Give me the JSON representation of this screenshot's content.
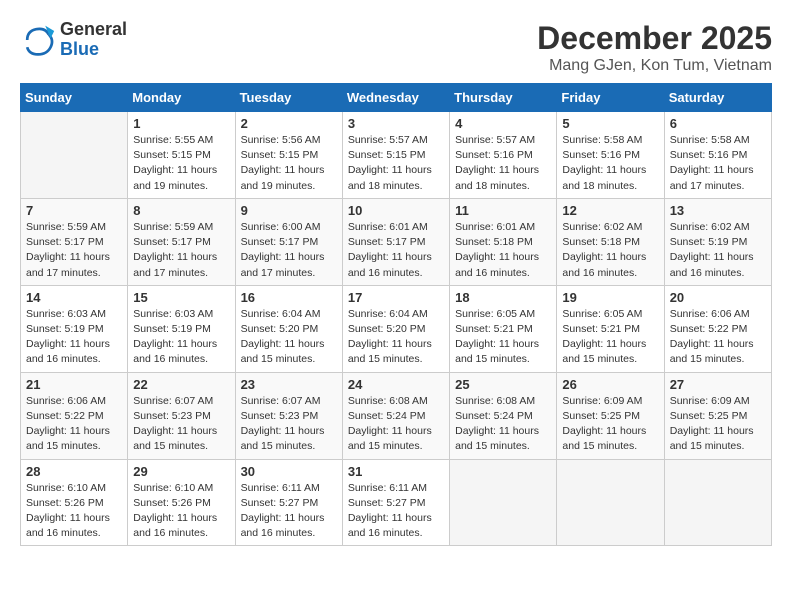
{
  "header": {
    "logo_general": "General",
    "logo_blue": "Blue",
    "title": "December 2025",
    "subtitle": "Mang GJen, Kon Tum, Vietnam"
  },
  "weekdays": [
    "Sunday",
    "Monday",
    "Tuesday",
    "Wednesday",
    "Thursday",
    "Friday",
    "Saturday"
  ],
  "weeks": [
    [
      {
        "day": "",
        "info": ""
      },
      {
        "day": "1",
        "info": "Sunrise: 5:55 AM\nSunset: 5:15 PM\nDaylight: 11 hours\nand 19 minutes."
      },
      {
        "day": "2",
        "info": "Sunrise: 5:56 AM\nSunset: 5:15 PM\nDaylight: 11 hours\nand 19 minutes."
      },
      {
        "day": "3",
        "info": "Sunrise: 5:57 AM\nSunset: 5:15 PM\nDaylight: 11 hours\nand 18 minutes."
      },
      {
        "day": "4",
        "info": "Sunrise: 5:57 AM\nSunset: 5:16 PM\nDaylight: 11 hours\nand 18 minutes."
      },
      {
        "day": "5",
        "info": "Sunrise: 5:58 AM\nSunset: 5:16 PM\nDaylight: 11 hours\nand 18 minutes."
      },
      {
        "day": "6",
        "info": "Sunrise: 5:58 AM\nSunset: 5:16 PM\nDaylight: 11 hours\nand 17 minutes."
      }
    ],
    [
      {
        "day": "7",
        "info": "Sunrise: 5:59 AM\nSunset: 5:17 PM\nDaylight: 11 hours\nand 17 minutes."
      },
      {
        "day": "8",
        "info": "Sunrise: 5:59 AM\nSunset: 5:17 PM\nDaylight: 11 hours\nand 17 minutes."
      },
      {
        "day": "9",
        "info": "Sunrise: 6:00 AM\nSunset: 5:17 PM\nDaylight: 11 hours\nand 17 minutes."
      },
      {
        "day": "10",
        "info": "Sunrise: 6:01 AM\nSunset: 5:17 PM\nDaylight: 11 hours\nand 16 minutes."
      },
      {
        "day": "11",
        "info": "Sunrise: 6:01 AM\nSunset: 5:18 PM\nDaylight: 11 hours\nand 16 minutes."
      },
      {
        "day": "12",
        "info": "Sunrise: 6:02 AM\nSunset: 5:18 PM\nDaylight: 11 hours\nand 16 minutes."
      },
      {
        "day": "13",
        "info": "Sunrise: 6:02 AM\nSunset: 5:19 PM\nDaylight: 11 hours\nand 16 minutes."
      }
    ],
    [
      {
        "day": "14",
        "info": "Sunrise: 6:03 AM\nSunset: 5:19 PM\nDaylight: 11 hours\nand 16 minutes."
      },
      {
        "day": "15",
        "info": "Sunrise: 6:03 AM\nSunset: 5:19 PM\nDaylight: 11 hours\nand 16 minutes."
      },
      {
        "day": "16",
        "info": "Sunrise: 6:04 AM\nSunset: 5:20 PM\nDaylight: 11 hours\nand 15 minutes."
      },
      {
        "day": "17",
        "info": "Sunrise: 6:04 AM\nSunset: 5:20 PM\nDaylight: 11 hours\nand 15 minutes."
      },
      {
        "day": "18",
        "info": "Sunrise: 6:05 AM\nSunset: 5:21 PM\nDaylight: 11 hours\nand 15 minutes."
      },
      {
        "day": "19",
        "info": "Sunrise: 6:05 AM\nSunset: 5:21 PM\nDaylight: 11 hours\nand 15 minutes."
      },
      {
        "day": "20",
        "info": "Sunrise: 6:06 AM\nSunset: 5:22 PM\nDaylight: 11 hours\nand 15 minutes."
      }
    ],
    [
      {
        "day": "21",
        "info": "Sunrise: 6:06 AM\nSunset: 5:22 PM\nDaylight: 11 hours\nand 15 minutes."
      },
      {
        "day": "22",
        "info": "Sunrise: 6:07 AM\nSunset: 5:23 PM\nDaylight: 11 hours\nand 15 minutes."
      },
      {
        "day": "23",
        "info": "Sunrise: 6:07 AM\nSunset: 5:23 PM\nDaylight: 11 hours\nand 15 minutes."
      },
      {
        "day": "24",
        "info": "Sunrise: 6:08 AM\nSunset: 5:24 PM\nDaylight: 11 hours\nand 15 minutes."
      },
      {
        "day": "25",
        "info": "Sunrise: 6:08 AM\nSunset: 5:24 PM\nDaylight: 11 hours\nand 15 minutes."
      },
      {
        "day": "26",
        "info": "Sunrise: 6:09 AM\nSunset: 5:25 PM\nDaylight: 11 hours\nand 15 minutes."
      },
      {
        "day": "27",
        "info": "Sunrise: 6:09 AM\nSunset: 5:25 PM\nDaylight: 11 hours\nand 15 minutes."
      }
    ],
    [
      {
        "day": "28",
        "info": "Sunrise: 6:10 AM\nSunset: 5:26 PM\nDaylight: 11 hours\nand 16 minutes."
      },
      {
        "day": "29",
        "info": "Sunrise: 6:10 AM\nSunset: 5:26 PM\nDaylight: 11 hours\nand 16 minutes."
      },
      {
        "day": "30",
        "info": "Sunrise: 6:11 AM\nSunset: 5:27 PM\nDaylight: 11 hours\nand 16 minutes."
      },
      {
        "day": "31",
        "info": "Sunrise: 6:11 AM\nSunset: 5:27 PM\nDaylight: 11 hours\nand 16 minutes."
      },
      {
        "day": "",
        "info": ""
      },
      {
        "day": "",
        "info": ""
      },
      {
        "day": "",
        "info": ""
      }
    ]
  ]
}
